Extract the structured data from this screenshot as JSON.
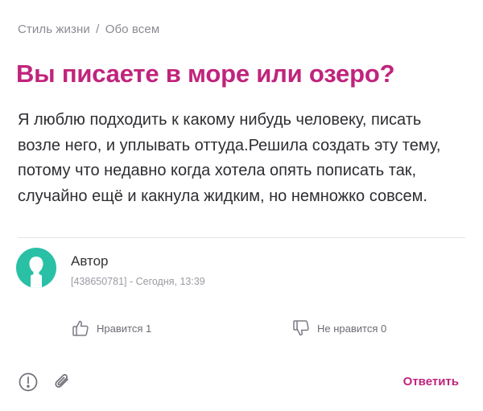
{
  "breadcrumb": {
    "category": "Стиль жизни",
    "separator": "/",
    "subcategory": "Обо всем"
  },
  "post": {
    "title": "Вы писаете в море или озеро?",
    "body": "Я люблю подходить к какому нибудь человеку, писать возле него, и уплывать оттуда.Решила создать эту тему, потому что недавно когда хотела опять пописать так, случайно ещё и какнула жидким, но немножко совсем."
  },
  "author": {
    "name": "Автор",
    "meta": "[438650781] - Сегодня, 13:39"
  },
  "actions": {
    "like_label": "Нравится 1",
    "dislike_label": "Не нравится 0",
    "reply_label": "Ответить"
  },
  "icons": {
    "like": "thumbs-up-icon",
    "dislike": "thumbs-down-icon",
    "report": "exclamation-circle-icon",
    "attach": "paperclip-icon",
    "avatar": "user-silhouette-icon"
  },
  "colors": {
    "accent": "#c0247c",
    "avatar_bg": "#29c0a6",
    "muted_text": "#8a8a93"
  }
}
